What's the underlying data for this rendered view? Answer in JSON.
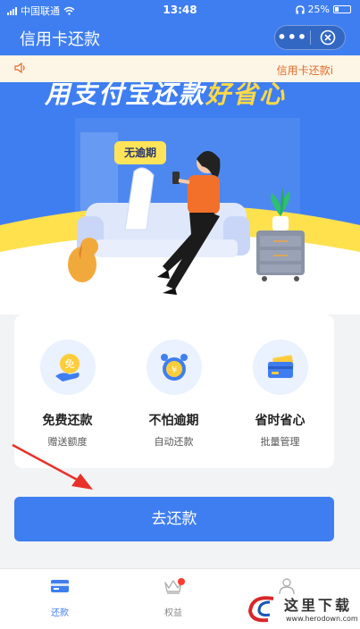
{
  "status_bar": {
    "carrier": "中国联通",
    "time": "13:48",
    "battery": "25%"
  },
  "nav": {
    "title": "信用卡还款",
    "more_label": "•••"
  },
  "notice": {
    "text": "信用卡还款i"
  },
  "banner": {
    "slogan_main": "用支付宝还款",
    "slogan_highlight": "好省心",
    "tag": "无逾期"
  },
  "features": [
    {
      "title": "免费还款",
      "subtitle": "赠送额度",
      "icon": "free-coin-icon",
      "badge": "免"
    },
    {
      "title": "不怕逾期",
      "subtitle": "自动还款",
      "icon": "alarm-clock-icon",
      "badge": "¥"
    },
    {
      "title": "省时省心",
      "subtitle": "批量管理",
      "icon": "cards-icon"
    }
  ],
  "repay_button": {
    "label": "去还款"
  },
  "tabs": [
    {
      "label": "还款",
      "icon": "card-icon",
      "active": true
    },
    {
      "label": "权益",
      "icon": "crown-icon",
      "active": false,
      "dot": true
    },
    {
      "label": "",
      "icon": "user-icon",
      "active": false
    }
  ],
  "watermark": {
    "text": "这里下载",
    "url": "www.herodown.com"
  },
  "colors": {
    "primary": "#3f7ef0",
    "accent_yellow": "#ffd948",
    "notice_bg": "#fdf6e6",
    "notice_text": "#e06a2a",
    "badge_red": "#ff3b30"
  }
}
